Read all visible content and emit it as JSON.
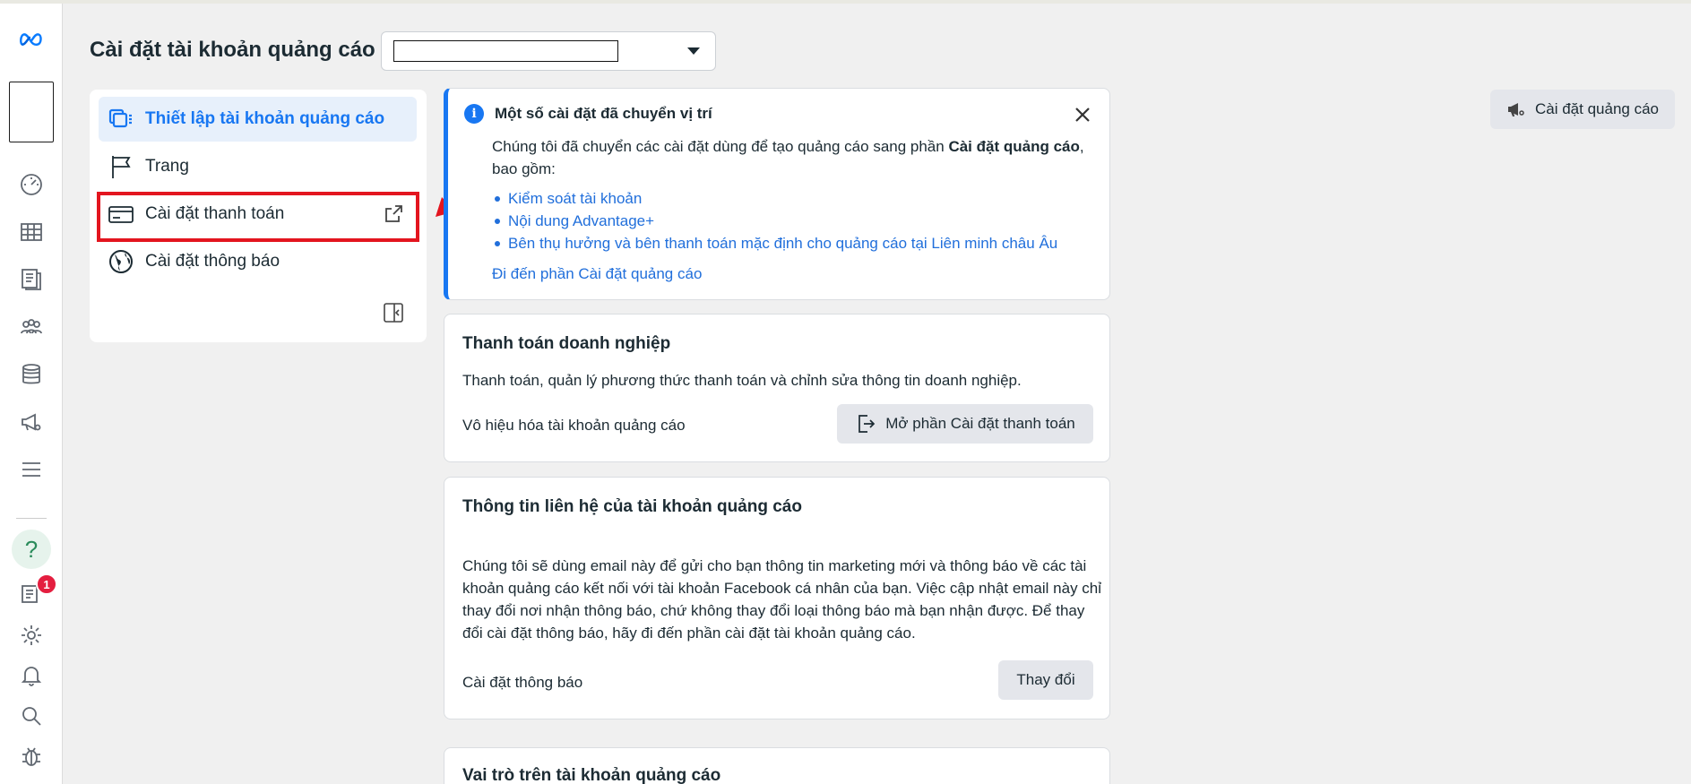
{
  "header": {
    "title": "Cài đặt tài khoản quảng cáo",
    "right_button": "Cài đặt quảng cáo"
  },
  "settings_nav": {
    "items": [
      {
        "label": "Thiết lập tài khoản quảng cáo",
        "icon": "ad-account-settings-icon",
        "active": true
      },
      {
        "label": "Trang",
        "icon": "flag-icon"
      },
      {
        "label": "Cài đặt thanh toán",
        "icon": "credit-card-icon",
        "external": true
      },
      {
        "label": "Cài đặt thông báo",
        "icon": "globe-icon"
      }
    ]
  },
  "info_banner": {
    "title": "Một số cài đặt đã chuyển vị trí",
    "body_prefix": "Chúng tôi đã chuyển các cài đặt dùng để tạo quảng cáo sang phần ",
    "body_bold": "Cài đặt quảng cáo",
    "body_suffix": ", bao gồm:",
    "links": [
      "Kiểm soát tài khoản",
      "Nội dung Advantage+",
      "Bên thụ hưởng và bên thanh toán mặc định cho quảng cáo tại Liên minh châu Âu"
    ],
    "goto_link": "Đi đến phần Cài đặt quảng cáo"
  },
  "payment_card": {
    "title": "Thanh toán doanh nghiệp",
    "description": "Thanh toán, quản lý phương thức thanh toán và chỉnh sửa thông tin doanh nghiệp.",
    "disable_link": "Vô hiệu hóa tài khoản quảng cáo",
    "open_button": "Mở phần Cài đặt thanh toán"
  },
  "contact_card": {
    "title": "Thông tin liên hệ của tài khoản quảng cáo",
    "description": "Chúng tôi sẽ dùng email này để gửi cho bạn thông tin marketing mới và thông báo về các tài khoản quảng cáo kết nối với tài khoản Facebook cá nhân của bạn. Việc cập nhật email này chỉ thay đổi nơi nhận thông báo, chứ không thay đổi loại thông báo mà bạn nhận được. Để thay đổi cài đặt thông báo, hãy đi đến phần cài đặt tài khoản quảng cáo.",
    "notif_link": "Cài đặt thông báo",
    "change_button": "Thay đổi"
  },
  "roles_card": {
    "title": "Vai trò trên tài khoản quảng cáo"
  },
  "rail": {
    "notification_count": "1"
  },
  "colors": {
    "accent": "#1877f2",
    "highlight": "#e3151f",
    "badge": "#e41e3f"
  }
}
